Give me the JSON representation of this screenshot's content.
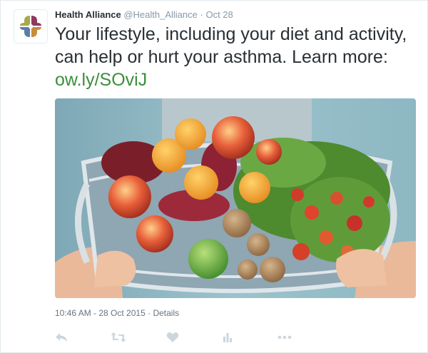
{
  "tweet": {
    "author_name": "Health Alliance",
    "author_handle": "@Health_Alliance",
    "separator": "·",
    "date": "Oct 28",
    "text_main": "Your lifestyle, including your diet and activity, can help or hurt your asthma. Learn more: ",
    "link_text": "ow.ly/SOviJ",
    "timestamp": "10:46 AM - 28 Oct 2015",
    "details_link": "Details",
    "media_alt": "Basket of fresh fruits and vegetables"
  },
  "avatar": {
    "logo_colors": [
      "#a6a94e",
      "#8e3a5c",
      "#5a7fa6",
      "#c88d3a"
    ]
  },
  "actions": [
    {
      "icon": "reply-icon"
    },
    {
      "icon": "retweet-icon"
    },
    {
      "icon": "like-icon"
    },
    {
      "icon": "analytics-icon"
    },
    {
      "icon": "more-icon"
    }
  ],
  "colors": {
    "link": "#3b8f3a",
    "muted": "#8899a6",
    "icon": "#ccd6dd",
    "text": "#292f33"
  }
}
